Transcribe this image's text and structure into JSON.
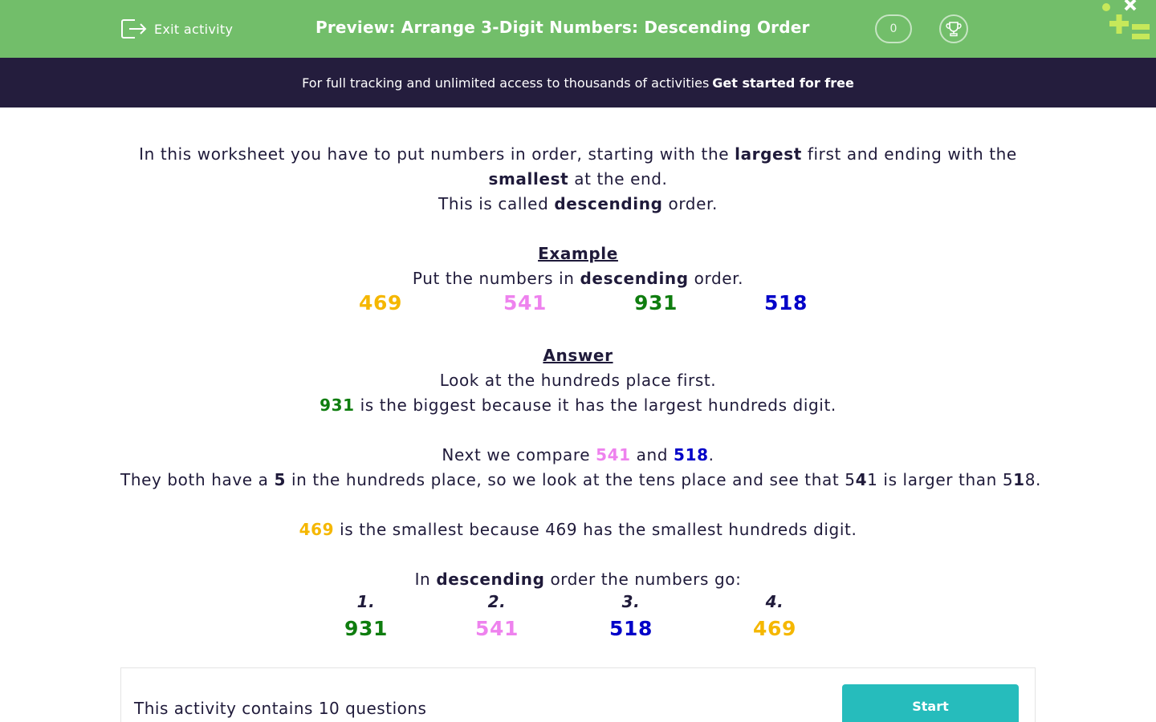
{
  "header": {
    "exit_label": "Exit activity",
    "title": "Preview: Arrange 3-Digit Numbers: Descending Order",
    "score": "0"
  },
  "banner": {
    "text": "For full tracking and unlimited access to thousands of activities",
    "cta": "Get started for free"
  },
  "intro": {
    "line1_a": "In this worksheet you have to put numbers in order, starting with the",
    "line1_b": "largest",
    "line1_c": "first and ending with the",
    "line2_a": "smallest",
    "line2_b": "at the end.",
    "line3_a": "This is called",
    "line3_b": "descending",
    "line3_c": "order."
  },
  "example": {
    "heading": "Example",
    "prompt_a": "Put the numbers in",
    "prompt_b": "descending",
    "prompt_c": "order.",
    "numbers": [
      "469",
      "541",
      "931",
      "518"
    ]
  },
  "answer": {
    "heading": "Answer",
    "line1": "Look at the hundreds place first.",
    "line2_num": "931",
    "line2_text": "is the biggest because it has the largest hundreds digit.",
    "line3_a": "Next we compare",
    "line3_n1": "541",
    "line3_b": "and",
    "line3_n2": "518",
    "line3_c": ".",
    "line4_a": "They both have a",
    "line4_b": "5",
    "line4_c": "in the hundreds place, so we look at the tens place and see that 5",
    "line4_d": "4",
    "line4_e": "1 is larger than 5",
    "line4_f": "1",
    "line4_g": "8.",
    "line5_num": "469",
    "line5_text": "is the smallest because 469 has the smallest hundreds digit.",
    "line6_a": "In",
    "line6_b": "descending",
    "line6_c": "order the numbers go:",
    "order_labels": [
      "1.",
      "2.",
      "3.",
      "4."
    ],
    "order_numbers": [
      "931",
      "541",
      "518",
      "469"
    ]
  },
  "footer": {
    "text": "This activity contains 10 questions",
    "start_label": "Start"
  },
  "colors": {
    "header_bg": "#72be6a",
    "banner_bg": "#241d3d",
    "text": "#1f1a3a",
    "yellow": "#f5b700",
    "pink": "#ee82ee",
    "green": "#0f7d0f",
    "blue": "#0000c8",
    "start_button": "#26bcbc"
  },
  "icons": {
    "exit": "exit-icon",
    "trophy": "trophy-icon",
    "logo": "logo-icon"
  }
}
